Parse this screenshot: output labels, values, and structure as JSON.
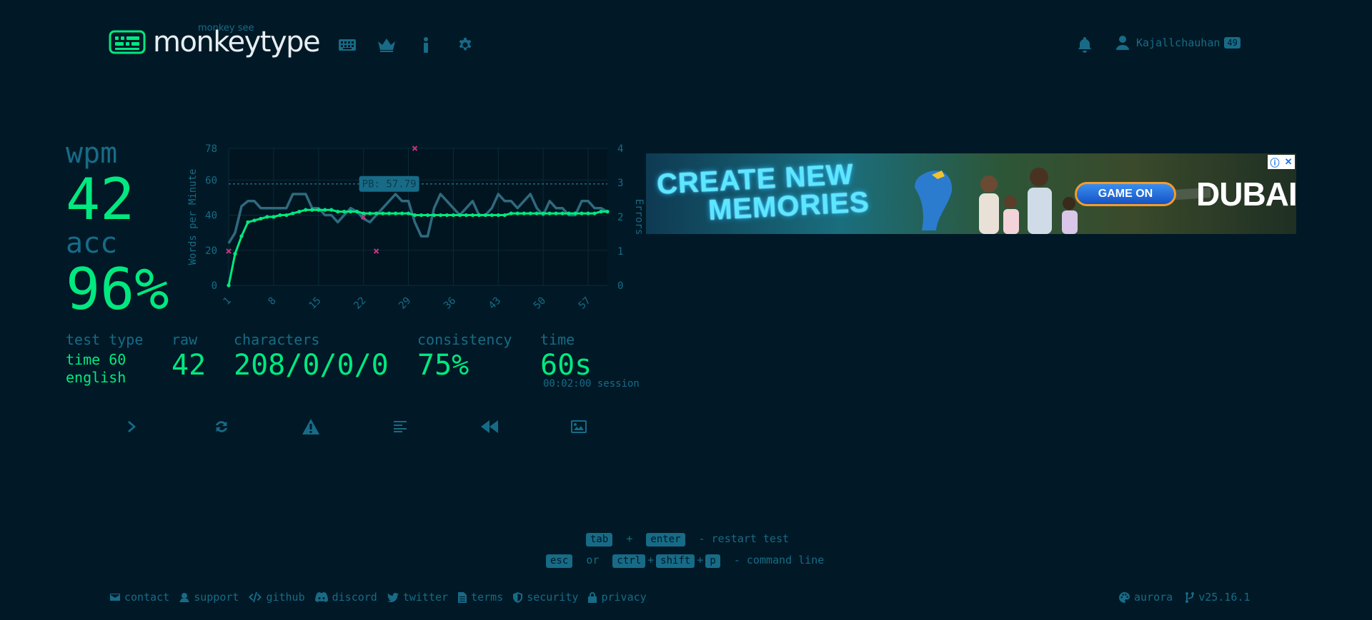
{
  "header": {
    "logo_sub": "monkey see",
    "logo_title": "monkeytype",
    "nav_icons": [
      "keyboard-icon",
      "crown-icon",
      "info-icon",
      "gear-icon"
    ],
    "account_name": "Kajallchauhan",
    "account_level": "49"
  },
  "result": {
    "wpm_label": "wpm",
    "wpm_value": "42",
    "acc_label": "acc",
    "acc_value": "96%",
    "test_type_label": "test type",
    "test_type_value_1": "time 60",
    "test_type_value_2": "english",
    "raw_label": "raw",
    "raw_value": "42",
    "characters_label": "characters",
    "characters_value": "208/0/0/0",
    "consistency_label": "consistency",
    "consistency_value": "75%",
    "time_label": "time",
    "time_value": "60s",
    "session_text": "00:02:00 session"
  },
  "chart_data": {
    "type": "line",
    "ylabel": "Words per Minute",
    "y2label": "Errors",
    "ylim": [
      0,
      78
    ],
    "y2lim": [
      0,
      4
    ],
    "y_ticks": [
      0,
      20,
      40,
      60,
      78
    ],
    "y2_ticks": [
      0,
      1,
      2,
      3,
      4
    ],
    "x_ticks": [
      1,
      8,
      15,
      22,
      29,
      36,
      43,
      50,
      57
    ],
    "xlim": [
      1,
      60
    ],
    "pb_label": "PB: 57.79",
    "pb_value": 57.79,
    "grid": true,
    "series": [
      {
        "name": "raw",
        "color": "#2f6a7e",
        "x": [
          1,
          2,
          3,
          4,
          5,
          6,
          7,
          8,
          9,
          10,
          11,
          12,
          13,
          14,
          15,
          16,
          17,
          18,
          19,
          20,
          21,
          22,
          23,
          24,
          25,
          26,
          27,
          28,
          29,
          30,
          31,
          32,
          33,
          34,
          35,
          36,
          37,
          38,
          39,
          40,
          41,
          42,
          43,
          44,
          45,
          46,
          47,
          48,
          49,
          50,
          51,
          52,
          53,
          54,
          55,
          56,
          57,
          58,
          59,
          60
        ],
        "values": [
          24,
          30,
          45,
          48,
          48,
          44,
          44,
          44,
          44,
          44,
          52,
          52,
          52,
          44,
          44,
          40,
          40,
          36,
          40,
          44,
          42,
          38,
          36,
          40,
          44,
          48,
          52,
          48,
          48,
          36,
          28,
          28,
          44,
          52,
          48,
          44,
          40,
          44,
          48,
          40,
          40,
          44,
          52,
          48,
          48,
          44,
          48,
          52,
          44,
          40,
          48,
          44,
          44,
          40,
          40,
          48,
          48,
          44,
          44,
          42
        ]
      },
      {
        "name": "wpm",
        "color": "#00e980",
        "x": [
          1,
          2,
          3,
          4,
          5,
          6,
          7,
          8,
          9,
          10,
          11,
          12,
          13,
          14,
          15,
          16,
          17,
          18,
          19,
          20,
          21,
          22,
          23,
          24,
          25,
          26,
          27,
          28,
          29,
          30,
          31,
          32,
          33,
          34,
          35,
          36,
          37,
          38,
          39,
          40,
          41,
          42,
          43,
          44,
          45,
          46,
          47,
          48,
          49,
          50,
          51,
          52,
          53,
          54,
          55,
          56,
          57,
          58,
          59,
          60
        ],
        "values": [
          0,
          18,
          28,
          36,
          37,
          38,
          39,
          39,
          40,
          40,
          41,
          42,
          43,
          43,
          43,
          43,
          43,
          42,
          42,
          42,
          42,
          41,
          41,
          41,
          41,
          41,
          41,
          41,
          41,
          40,
          40,
          40,
          40,
          40,
          40,
          40,
          40,
          40,
          40,
          40,
          40,
          40,
          40,
          40,
          41,
          41,
          41,
          41,
          41,
          41,
          41,
          41,
          41,
          41,
          41,
          41,
          41,
          41,
          42,
          42
        ]
      },
      {
        "name": "errors",
        "color": "#c7337e",
        "type": "scatter",
        "x": [
          1,
          22,
          24,
          30
        ],
        "values": [
          1,
          2,
          1,
          4
        ]
      }
    ]
  },
  "ad": {
    "headline_1": "CREATE NEW",
    "headline_2": "MEMORIES",
    "cta": "GAME ON",
    "brand": "DUBAI",
    "info_icon": "ⓘ",
    "close_icon": "✕"
  },
  "actions": [
    "next-test",
    "restart-test",
    "report",
    "words-history",
    "replay",
    "save-screenshot"
  ],
  "shortcuts": {
    "tab": "tab",
    "plus": "+",
    "enter": "enter",
    "restart_text": "- restart test",
    "esc": "esc",
    "or": "or",
    "ctrl": "ctrl",
    "shift": "shift",
    "p": "p",
    "command_text": "- command line"
  },
  "footer": {
    "contact": "contact",
    "support": "support",
    "github": "github",
    "discord": "discord",
    "twitter": "twitter",
    "terms": "terms",
    "security": "security",
    "privacy": "privacy",
    "theme": "aurora",
    "version": "v25.16.1"
  },
  "colors": {
    "background": "#011926",
    "main": "#00e980",
    "sub": "#176b87",
    "text": "#e7eef2",
    "error": "#c7337e"
  }
}
